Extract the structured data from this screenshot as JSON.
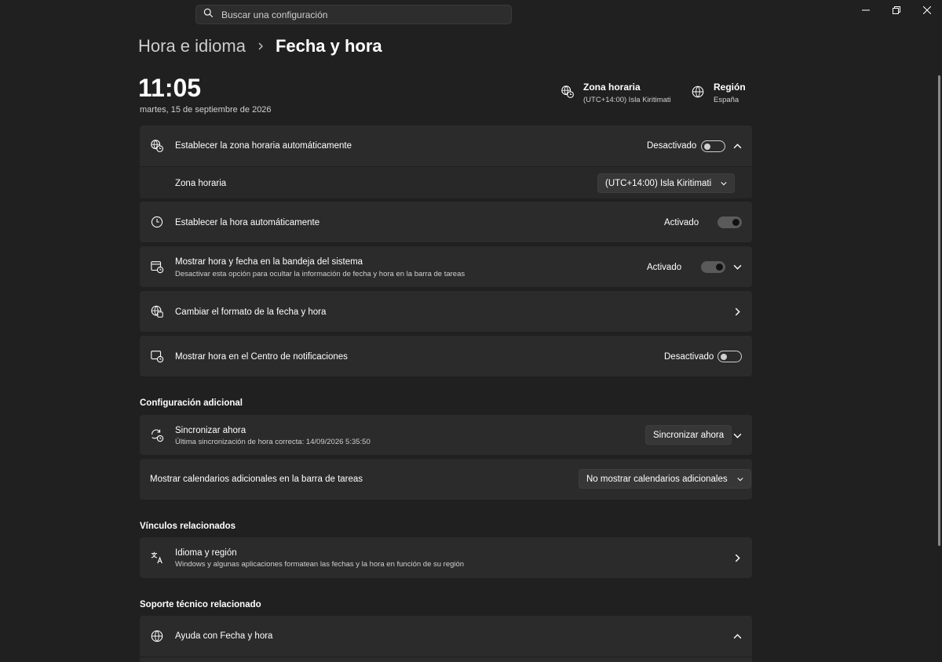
{
  "search": {
    "placeholder": "Buscar una configuración"
  },
  "breadcrumb": {
    "parent": "Hora e idioma",
    "current": "Fecha y hora"
  },
  "clock": {
    "time": "11:05",
    "date": "martes, 15 de septiembre de 2026"
  },
  "header": {
    "timezone": {
      "title": "Zona horaria",
      "value": "(UTC+14:00) Isla Kiritimati"
    },
    "region": {
      "title": "Región",
      "value": "España"
    }
  },
  "settings": {
    "auto_timezone": {
      "label": "Establecer la zona horaria automáticamente",
      "state": "Desactivado",
      "on": false
    },
    "timezone": {
      "label": "Zona horaria",
      "value": "(UTC+14:00) Isla Kiritimati"
    },
    "auto_time": {
      "label": "Establecer la hora automáticamente",
      "state": "Activado",
      "on": true
    },
    "tray": {
      "label": "Mostrar hora y fecha en la bandeja del sistema",
      "sub": "Desactivar esta opción para ocultar la información de fecha y hora en la barra de tareas",
      "state": "Activado",
      "on": true
    },
    "format": {
      "label": "Cambiar el formato de la fecha y hora"
    },
    "notif": {
      "label": "Mostrar hora en el Centro de notificaciones",
      "state": "Desactivado",
      "on": false
    }
  },
  "additional": {
    "title": "Configuración adicional",
    "sync": {
      "label": "Sincronizar ahora",
      "sub": "Última sincronización de hora correcta: 14/09/2026 5:35:50",
      "button": "Sincronizar ahora"
    },
    "calendars": {
      "label": "Mostrar calendarios adicionales en la barra de tareas",
      "value": "No mostrar calendarios adicionales"
    }
  },
  "related": {
    "title": "Vínculos relacionados",
    "lang": {
      "label": "Idioma y región",
      "sub": "Windows y algunas aplicaciones formatean las fechas y la hora en función de su región"
    }
  },
  "support": {
    "title": "Soporte técnico relacionado",
    "help": {
      "label": "Ayuda con Fecha y hora"
    }
  }
}
